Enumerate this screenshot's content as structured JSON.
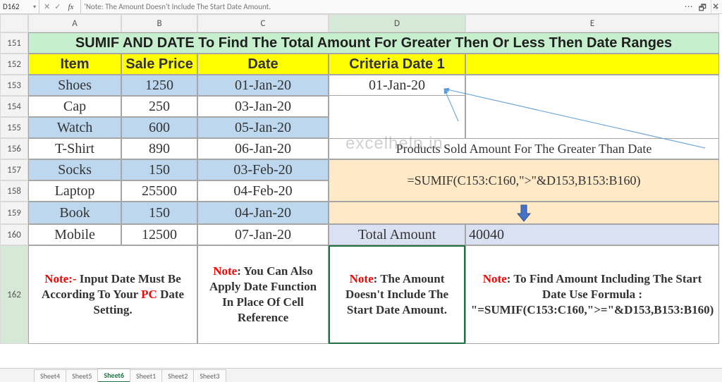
{
  "name_box": "D162",
  "formula_bar_text": "'Note: The Amount Doesn't Include The Start Date Amount.",
  "watermark": "excelhelp.in",
  "columns": [
    "A",
    "B",
    "C",
    "D",
    "E"
  ],
  "active_column": "D",
  "rows": [
    "151",
    "152",
    "153",
    "154",
    "155",
    "156",
    "157",
    "158",
    "159",
    "160",
    "162"
  ],
  "active_row": "162",
  "title_banner": "SUMIF AND DATE To Find The Total Amount For Greater Then Or Less Then Date Ranges",
  "headers": {
    "A": "Item",
    "B": "Sale Price",
    "C": "Date",
    "D": "Criteria Date 1",
    "E": ""
  },
  "data_rows": [
    {
      "r": "153",
      "item": "Shoes",
      "price": "1250",
      "date": "01-Jan-20",
      "blue": true
    },
    {
      "r": "154",
      "item": "Cap",
      "price": "250",
      "date": "03-Jan-20",
      "blue": false
    },
    {
      "r": "155",
      "item": "Watch",
      "price": "600",
      "date": "05-Jan-20",
      "blue": true
    },
    {
      "r": "156",
      "item": "T-Shirt",
      "price": "890",
      "date": "06-Jan-20",
      "blue": false
    },
    {
      "r": "157",
      "item": "Socks",
      "price": "150",
      "date": "03-Feb-20",
      "blue": true
    },
    {
      "r": "158",
      "item": "Laptop",
      "price": "25500",
      "date": "04-Feb-20",
      "blue": false
    },
    {
      "r": "159",
      "item": "Book",
      "price": "150",
      "date": "04-Jan-20",
      "blue": true
    },
    {
      "r": "160",
      "item": "Mobile",
      "price": "12500",
      "date": "07-Jan-20",
      "blue": false
    }
  ],
  "criteria_date": "01-Jan-20",
  "caption_156": "Products Sold Amount For The Greater Than Date",
  "formula_display": "=SUMIF(C153:C160,\">\"&D153,B153:B160)",
  "total_label": "Total Amount",
  "total_value": "40040",
  "notes": {
    "a": {
      "prefix": "Note:-",
      "body1": " Input Date Must Be According To Your ",
      "pc": "PC",
      "body2": " Date Setting."
    },
    "c": {
      "prefix": "Note",
      "body": ": You Can Also Apply Date Function In Place Of Cell Reference"
    },
    "d": {
      "prefix": "Note",
      "body": ": The Amount Doesn't Include The Start Date Amount."
    },
    "e": {
      "prefix": "Note",
      "body": ": To Find Amount Including The Start Date Use Formula : \"=SUMIF(C153:C160,\">=\"&D153,B153:B160)"
    }
  },
  "sheet_tabs": [
    "Sheet4",
    "Sheet5",
    "Sheet6",
    "Sheet1",
    "Sheet2",
    "Sheet3"
  ],
  "active_sheet": "Sheet6",
  "chart_data": {
    "type": "table",
    "title": "SUMIF AND DATE example",
    "columns": [
      "Item",
      "Sale Price",
      "Date"
    ],
    "rows": [
      [
        "Shoes",
        1250,
        "2020-01-01"
      ],
      [
        "Cap",
        250,
        "2020-01-03"
      ],
      [
        "Watch",
        600,
        "2020-01-05"
      ],
      [
        "T-Shirt",
        890,
        "2020-01-06"
      ],
      [
        "Socks",
        150,
        "2020-02-03"
      ],
      [
        "Laptop",
        25500,
        "2020-02-04"
      ],
      [
        "Book",
        150,
        "2020-01-04"
      ],
      [
        "Mobile",
        12500,
        "2020-01-07"
      ]
    ],
    "criteria_date": "2020-01-01",
    "formula": "=SUMIF(C153:C160,\">\"&D153,B153:B160)",
    "result": 40040
  }
}
